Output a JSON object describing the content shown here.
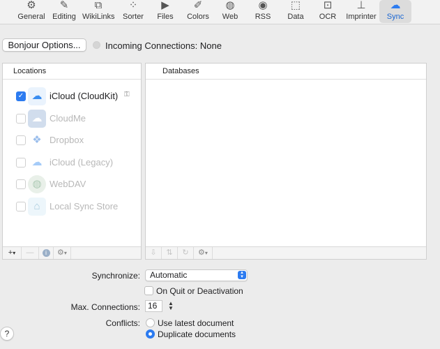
{
  "toolbar": {
    "tabs": [
      {
        "label": "General",
        "icon": "gear-icon",
        "glyph": "⚙"
      },
      {
        "label": "Editing",
        "icon": "pen-icon",
        "glyph": "✎"
      },
      {
        "label": "WikiLinks",
        "icon": "wikilinks-icon",
        "glyph": "⧉"
      },
      {
        "label": "Sorter",
        "icon": "sorter-icon",
        "glyph": "⁘"
      },
      {
        "label": "Files",
        "icon": "files-icon",
        "glyph": "▶"
      },
      {
        "label": "Colors",
        "icon": "paintbrush-icon",
        "glyph": "✐"
      },
      {
        "label": "Web",
        "icon": "globe-icon",
        "glyph": "◍"
      },
      {
        "label": "RSS",
        "icon": "rss-icon",
        "glyph": "◉"
      },
      {
        "label": "Data",
        "icon": "data-icon",
        "glyph": "⬚"
      },
      {
        "label": "OCR",
        "icon": "ocr-icon",
        "glyph": "⊡"
      },
      {
        "label": "Imprinter",
        "icon": "stamp-icon",
        "glyph": "⊥"
      },
      {
        "label": "Sync",
        "icon": "cloud-icon",
        "glyph": "☁"
      }
    ],
    "active": "Sync",
    "accent": "#2c7bf0"
  },
  "bonjour": {
    "button_label": "Bonjour Options...",
    "incoming_text": "Incoming Connections: None"
  },
  "locations": {
    "header": "Locations",
    "items": [
      {
        "label": "iCloud (CloudKit)",
        "checked": true,
        "enabled": true,
        "icon": "icloud-icon",
        "glyph": "☁"
      },
      {
        "label": "CloudMe",
        "checked": false,
        "enabled": false,
        "icon": "cloudme-icon",
        "glyph": "☁"
      },
      {
        "label": "Dropbox",
        "checked": false,
        "enabled": false,
        "icon": "dropbox-icon",
        "glyph": "❖"
      },
      {
        "label": "iCloud (Legacy)",
        "checked": false,
        "enabled": false,
        "icon": "icloud-legacy-icon",
        "glyph": "☁"
      },
      {
        "label": "WebDAV",
        "checked": false,
        "enabled": false,
        "icon": "webdav-icon",
        "glyph": "◍"
      },
      {
        "label": "Local Sync Store",
        "checked": false,
        "enabled": false,
        "icon": "local-store-icon",
        "glyph": "⌂"
      }
    ],
    "footer": {
      "add": "+",
      "remove": "—",
      "info": "i",
      "action": "⚙"
    }
  },
  "databases": {
    "header": "Databases",
    "footer": {
      "import": "⇩",
      "sync": "⇅",
      "refresh": "↻",
      "action": "⚙"
    }
  },
  "form": {
    "synchronize_label": "Synchronize:",
    "synchronize_value": "Automatic",
    "quit_label": "On Quit or Deactivation",
    "max_label": "Max. Connections:",
    "max_value": "16",
    "conflicts_label": "Conflicts:",
    "conflict_options": [
      "Use latest document",
      "Duplicate documents"
    ],
    "conflict_selected": 1
  },
  "help": {
    "label": "?"
  }
}
